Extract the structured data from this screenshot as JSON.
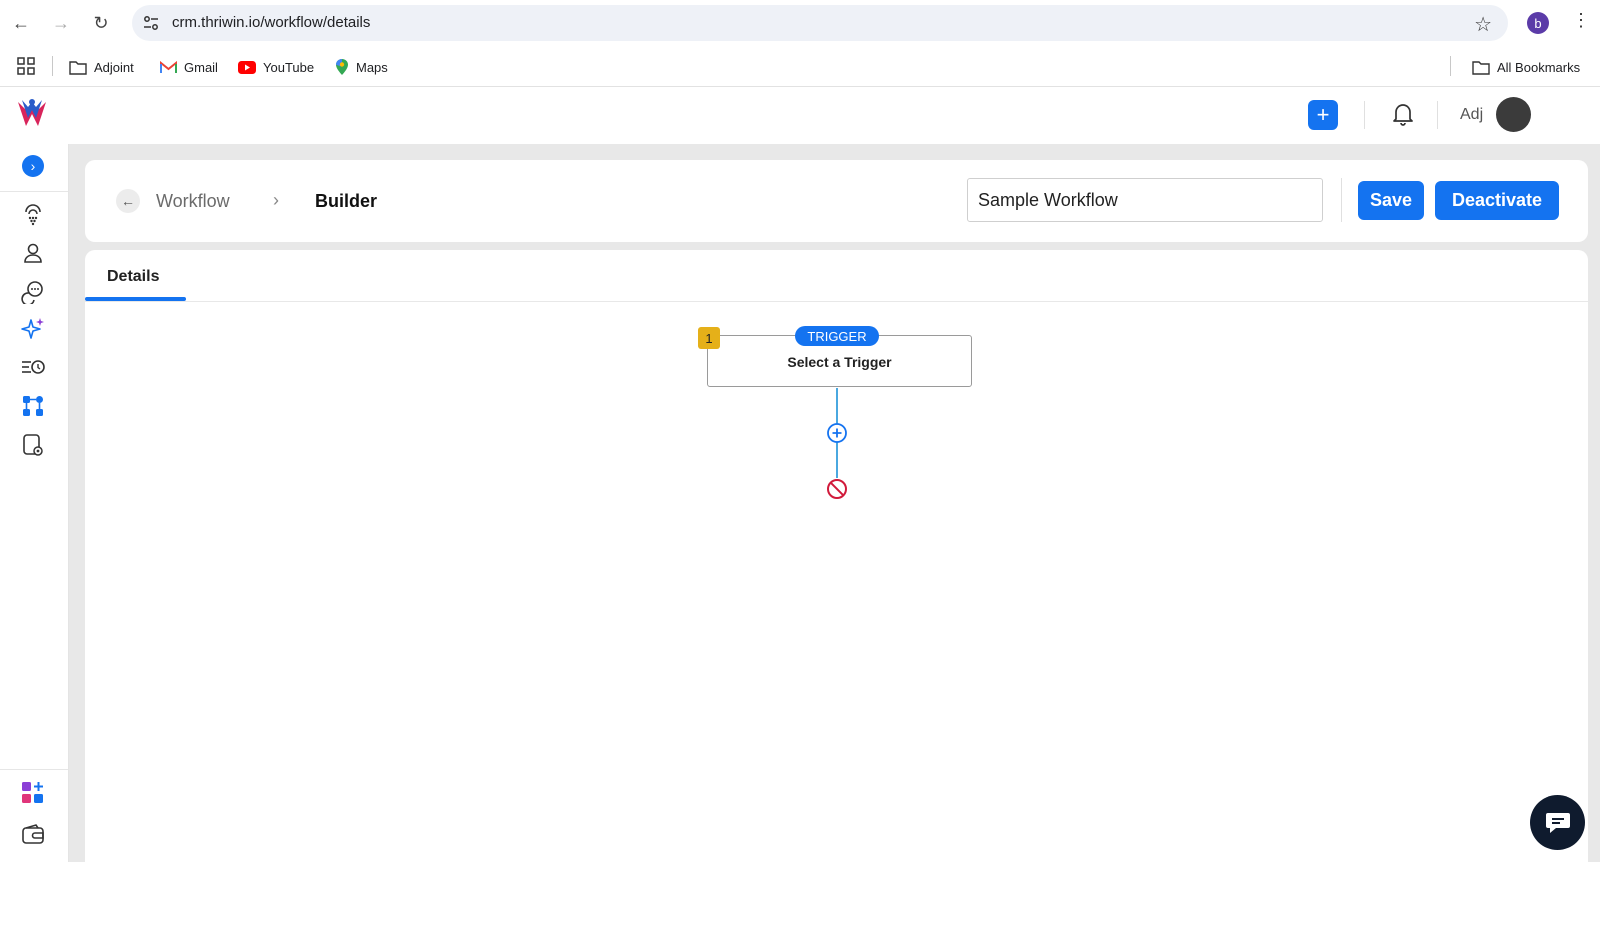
{
  "browser": {
    "url": "crm.thriwin.io/workflow/details",
    "profile_initial": "b",
    "bookmarks": [
      "Adjoint",
      "Gmail",
      "YouTube",
      "Maps"
    ],
    "all_bookmarks": "All Bookmarks"
  },
  "topbar": {
    "user_name": "Adj"
  },
  "breadcrumb": {
    "parent": "Workflow",
    "current": "Builder"
  },
  "workflow": {
    "name_value": "Sample Workflow",
    "save_label": "Save",
    "deactivate_label": "Deactivate"
  },
  "tabs": {
    "details": "Details"
  },
  "canvas": {
    "step_number": "1",
    "trigger_badge": "TRIGGER",
    "trigger_text": "Select a Trigger"
  },
  "colors": {
    "primary": "#1473f0",
    "step_badge": "#e5b019",
    "end_node": "#d11a3b",
    "connector": "#4aa8e0"
  }
}
